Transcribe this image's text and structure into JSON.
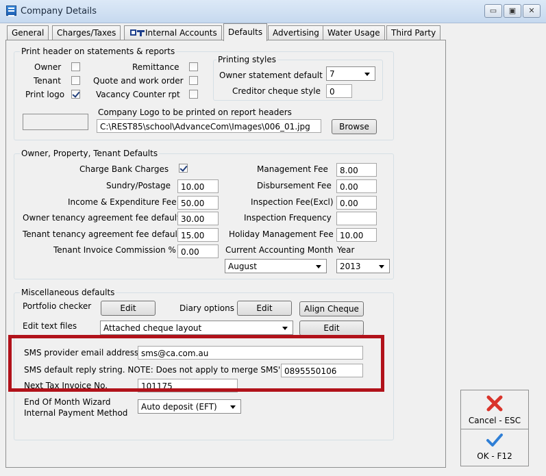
{
  "window": {
    "title": "Company Details",
    "controls": [
      "▭",
      "▣",
      "✕"
    ]
  },
  "tabs": [
    {
      "label": "General"
    },
    {
      "label": "Charges/Taxes"
    },
    {
      "label": "Internal Accounts"
    },
    {
      "label": "Defaults"
    },
    {
      "label": "Advertising"
    },
    {
      "label": "Water Usage"
    },
    {
      "label": "Third Party"
    }
  ],
  "print_header": {
    "title": "Print header on statements & reports",
    "owner_label": "Owner",
    "tenant_label": "Tenant",
    "print_logo_label": "Print logo",
    "print_logo_checked": true,
    "remittance_label": "Remittance",
    "quote_label": "Quote and work order",
    "vacancy_label": "Vacancy Counter rpt",
    "printing_styles_title": "Printing styles",
    "owner_statement_label": "Owner statement default",
    "owner_statement_value": "7",
    "creditor_cheque_label": "Creditor cheque style",
    "creditor_cheque_value": "0",
    "logo_label": "Company Logo to be printed on report headers",
    "logo_path": "C:\\REST85\\school\\AdvanceCom\\Images\\006_01.jpg",
    "browse_label": "Browse"
  },
  "defaults": {
    "title": "Owner, Property, Tenant Defaults",
    "charge_bank_label": "Charge Bank Charges",
    "charge_bank_checked": true,
    "sundry_label": "Sundry/Postage",
    "sundry_value": "10.00",
    "income_label": "Income & Expenditure Fee",
    "income_value": "50.00",
    "owner_tenancy_label": "Owner tenancy agreement fee default",
    "owner_tenancy_value": "30.00",
    "tenant_tenancy_label": "Tenant tenancy agreement fee default",
    "tenant_tenancy_value": "15.00",
    "tenant_invoice_label": "Tenant Invoice Commission %",
    "tenant_invoice_value": "0.00",
    "management_label": "Management Fee",
    "management_value": "8.00",
    "disbursement_label": "Disbursement Fee",
    "disbursement_value": "0.00",
    "inspection_fee_label": "Inspection Fee(Excl)",
    "inspection_fee_value": "0.00",
    "inspection_freq_label": "Inspection Frequency",
    "inspection_freq_value": "",
    "holiday_label": "Holiday Management Fee",
    "holiday_value": "10.00",
    "accounting_month_label": "Current Accounting Month",
    "year_label": "Year",
    "month_value": "August",
    "year_value": "2013"
  },
  "misc": {
    "title": "Miscellaneous defaults",
    "portfolio_label": "Portfolio checker",
    "portfolio_edit": "Edit",
    "diary_label": "Diary options",
    "diary_edit": "Edit",
    "align_cheque": "Align Cheque",
    "edit_text_label": "Edit text files",
    "text_file_value": "Attached cheque layout",
    "text_file_edit": "Edit",
    "sms_email_label": "SMS provider email address",
    "sms_email_value": "sms@ca.com.au",
    "sms_reply_label": "SMS default reply string. NOTE: Does not apply to merge SMS's",
    "sms_reply_value": "0895550106",
    "next_invoice_label": "Next Tax Invoice No.",
    "next_invoice_value": "101175",
    "eom_label_1": "End Of Month Wizard",
    "eom_label_2": "Internal Payment Method",
    "eom_value": "Auto deposit (EFT)"
  },
  "actions": {
    "cancel_label": "Cancel - ESC",
    "ok_label": "OK - F12"
  },
  "colors": {
    "highlight": "#b1121a",
    "cancel_icon": "#d9342b",
    "ok_icon": "#2f7fd6"
  }
}
